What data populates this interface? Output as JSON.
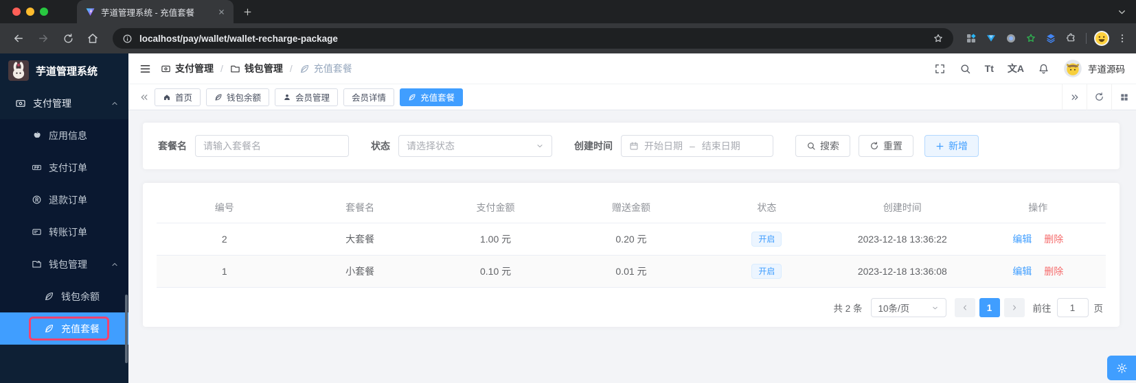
{
  "browser": {
    "tab_title": "芋道管理系统 - 充值套餐",
    "url": "localhost/pay/wallet/wallet-recharge-package"
  },
  "sidebar": {
    "logo_title": "芋道管理系统",
    "payment_label": "支付管理",
    "payment_items": [
      "应用信息",
      "支付订单",
      "退款订单",
      "转账订单"
    ],
    "wallet_label": "钱包管理",
    "wallet_items": [
      "钱包余额",
      "充值套餐"
    ]
  },
  "header": {
    "breadcrumb": [
      "支付管理",
      "钱包管理",
      "充值套餐"
    ],
    "separator": "/",
    "font_icon_label": "Tt",
    "locale_icon_label": "文A",
    "username": "芋道源码"
  },
  "tabs": [
    "首页",
    "钱包余额",
    "会员管理",
    "会员详情",
    "充值套餐"
  ],
  "filters": {
    "name_label": "套餐名",
    "name_placeholder": "请输入套餐名",
    "status_label": "状态",
    "status_placeholder": "请选择状态",
    "time_label": "创建时间",
    "start_placeholder": "开始日期",
    "separator": "–",
    "end_placeholder": "结束日期",
    "search_label": "搜索",
    "reset_label": "重置",
    "add_label": "新增"
  },
  "table": {
    "columns": [
      "编号",
      "套餐名",
      "支付金额",
      "赠送金额",
      "状态",
      "创建时间",
      "操作"
    ],
    "rows": [
      {
        "id": "2",
        "name": "大套餐",
        "pay": "1.00 元",
        "bonus": "0.20 元",
        "status": "开启",
        "created": "2023-12-18 13:36:22",
        "edit": "编辑",
        "delete": "删除"
      },
      {
        "id": "1",
        "name": "小套餐",
        "pay": "0.10 元",
        "bonus": "0.01 元",
        "status": "开启",
        "created": "2023-12-18 13:36:08",
        "edit": "编辑",
        "delete": "删除"
      }
    ]
  },
  "pagination": {
    "total": "共 2 条",
    "page_size": "10条/页",
    "current_page": "1",
    "goto_label": "前往",
    "goto_value": "1",
    "page_unit": "页"
  },
  "colors": {
    "primary": "#409eff",
    "danger": "#f56c6c",
    "tag_bg": "#ecf5ff",
    "sidebar_bg": "#0e2035",
    "active_highlight": "#f3426f"
  }
}
